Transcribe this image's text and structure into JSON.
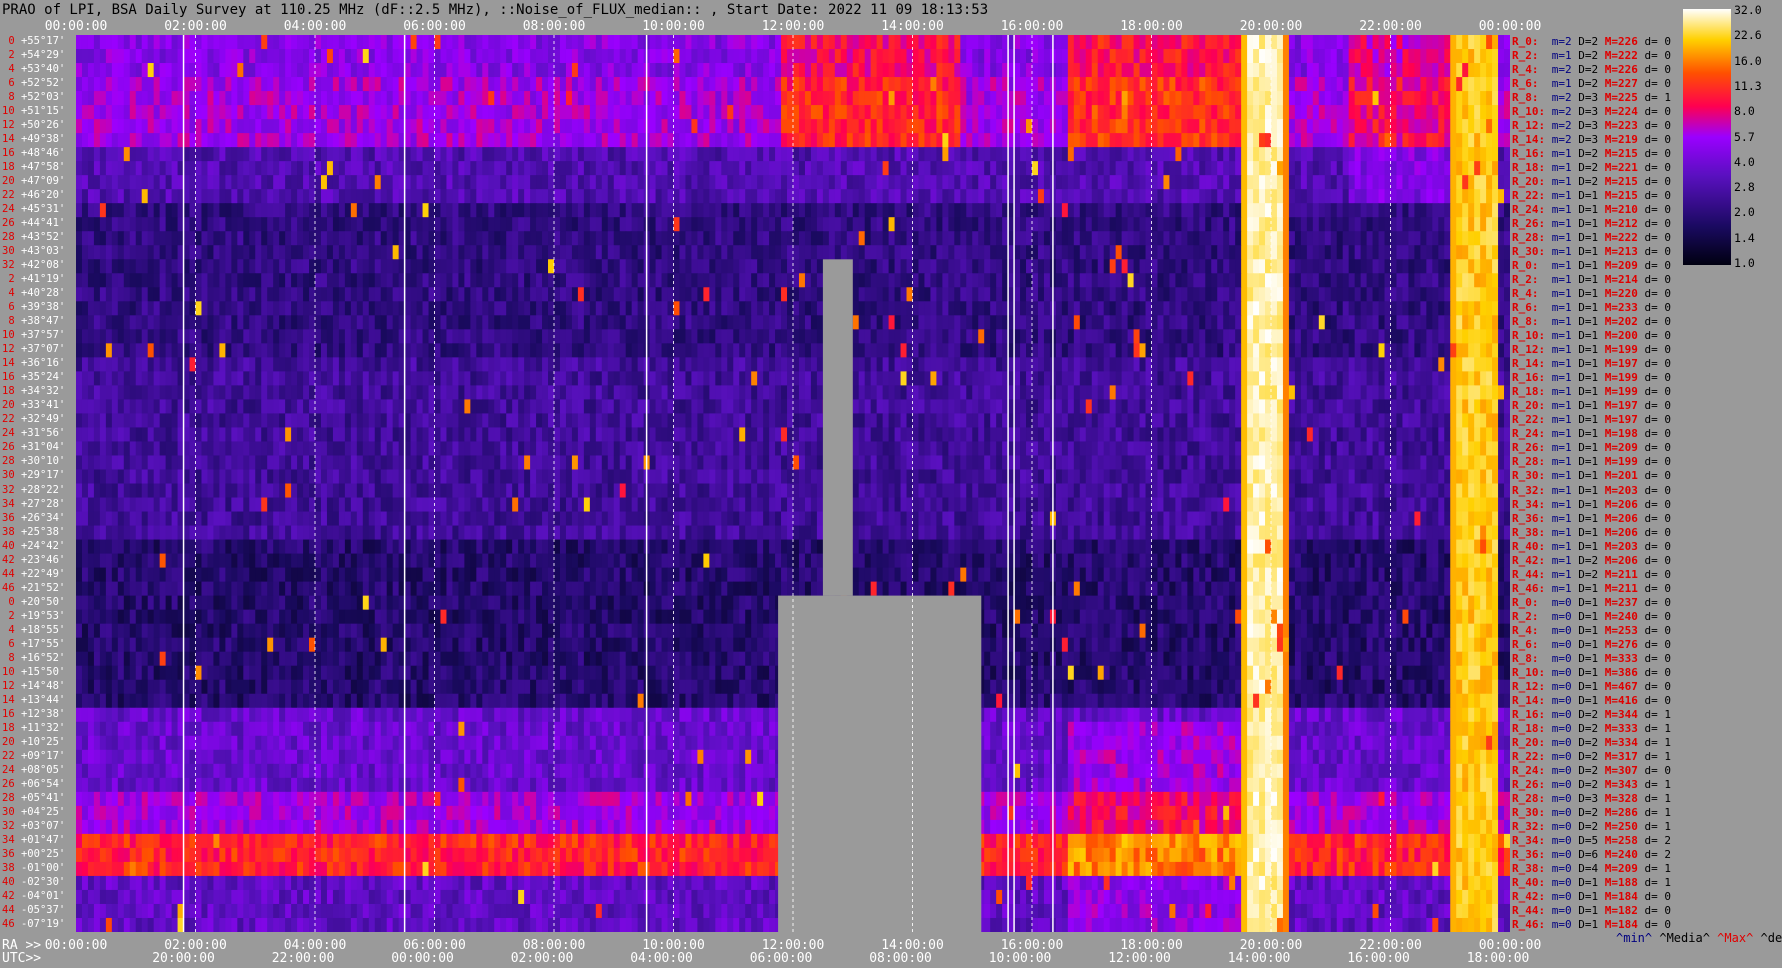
{
  "title": "PRAO of LPI, BSA Daily Survey at 110.25 MHz (dF::2.5 MHz), ::Noise_of_FLUX_median:: , Start Date: 2022 11 09 18:13:53",
  "top_ticks": [
    "00:00:00",
    "02:00:00",
    "04:00:00",
    "06:00:00",
    "08:00:00",
    "10:00:00",
    "12:00:00",
    "14:00:00",
    "16:00:00",
    "18:00:00",
    "20:00:00",
    "22:00:00",
    "00:00:00"
  ],
  "ra_prefix": "RA >>",
  "ra_ticks": [
    "00:00:00",
    "02:00:00",
    "04:00:00",
    "06:00:00",
    "08:00:00",
    "10:00:00",
    "12:00:00",
    "14:00:00",
    "16:00:00",
    "18:00:00",
    "20:00:00",
    "22:00:00",
    "00:00:00"
  ],
  "utc_prefix": "UTC>>",
  "utc_ticks": [
    "20:00:00",
    "22:00:00",
    "00:00:00",
    "02:00:00",
    "04:00:00",
    "06:00:00",
    "08:00:00",
    "10:00:00",
    "12:00:00",
    "14:00:00",
    "16:00:00",
    "18:00:00"
  ],
  "row_labels": [
    {
      "i": "0",
      "d": "+55°17'"
    },
    {
      "i": "2",
      "d": "+54°29'"
    },
    {
      "i": "4",
      "d": "+53°40'"
    },
    {
      "i": "6",
      "d": "+52°52'"
    },
    {
      "i": "8",
      "d": "+52°03'"
    },
    {
      "i": "10",
      "d": "+51°15'"
    },
    {
      "i": "12",
      "d": "+50°26'"
    },
    {
      "i": "14",
      "d": "+49°38'"
    },
    {
      "i": "16",
      "d": "+48°46'"
    },
    {
      "i": "18",
      "d": "+47°58'"
    },
    {
      "i": "20",
      "d": "+47°09'"
    },
    {
      "i": "22",
      "d": "+46°20'"
    },
    {
      "i": "24",
      "d": "+45°31'"
    },
    {
      "i": "26",
      "d": "+44°41'"
    },
    {
      "i": "28",
      "d": "+43°52'"
    },
    {
      "i": "30",
      "d": "+43°03'"
    },
    {
      "i": "32",
      "d": "+42°08'"
    },
    {
      "i": "2",
      "d": "+41°19'"
    },
    {
      "i": "4",
      "d": "+40°28'"
    },
    {
      "i": "6",
      "d": "+39°38'"
    },
    {
      "i": "8",
      "d": "+38°47'"
    },
    {
      "i": "10",
      "d": "+37°57'"
    },
    {
      "i": "12",
      "d": "+37°07'"
    },
    {
      "i": "14",
      "d": "+36°16'"
    },
    {
      "i": "16",
      "d": "+35°24'"
    },
    {
      "i": "18",
      "d": "+34°32'"
    },
    {
      "i": "20",
      "d": "+33°41'"
    },
    {
      "i": "22",
      "d": "+32°49'"
    },
    {
      "i": "24",
      "d": "+31°56'"
    },
    {
      "i": "26",
      "d": "+31°04'"
    },
    {
      "i": "28",
      "d": "+30°10'"
    },
    {
      "i": "30",
      "d": "+29°17'"
    },
    {
      "i": "32",
      "d": "+28°22'"
    },
    {
      "i": "34",
      "d": "+27°28'"
    },
    {
      "i": "36",
      "d": "+26°34'"
    },
    {
      "i": "38",
      "d": "+25°38'"
    },
    {
      "i": "40",
      "d": "+24°42'"
    },
    {
      "i": "42",
      "d": "+23°46'"
    },
    {
      "i": "44",
      "d": "+22°49'"
    },
    {
      "i": "46",
      "d": "+21°52'"
    },
    {
      "i": "0",
      "d": "+20°50'"
    },
    {
      "i": "2",
      "d": "+19°53'"
    },
    {
      "i": "4",
      "d": "+18°55'"
    },
    {
      "i": "6",
      "d": "+17°55'"
    },
    {
      "i": "8",
      "d": "+16°52'"
    },
    {
      "i": "10",
      "d": "+15°50'"
    },
    {
      "i": "12",
      "d": "+14°48'"
    },
    {
      "i": "14",
      "d": "+13°44'"
    },
    {
      "i": "16",
      "d": "+12°38'"
    },
    {
      "i": "18",
      "d": "+11°32'"
    },
    {
      "i": "20",
      "d": "+10°25'"
    },
    {
      "i": "22",
      "d": "+09°17'"
    },
    {
      "i": "24",
      "d": "+08°05'"
    },
    {
      "i": "26",
      "d": "+06°54'"
    },
    {
      "i": "28",
      "d": "+05°41'"
    },
    {
      "i": "30",
      "d": "+04°25'"
    },
    {
      "i": "32",
      "d": "+03°07'"
    },
    {
      "i": "34",
      "d": "+01°47'"
    },
    {
      "i": "36",
      "d": "+00°25'"
    },
    {
      "i": "38",
      "d": "-01°00'"
    },
    {
      "i": "40",
      "d": "-02°30'"
    },
    {
      "i": "42",
      "d": "-04°01'"
    },
    {
      "i": "44",
      "d": "-05°37'"
    },
    {
      "i": "46",
      "d": "-07°19'"
    }
  ],
  "stats": [
    [
      "R_0:",
      "m=2",
      "D=2",
      "M=226",
      "d= 0"
    ],
    [
      "R_2:",
      "m=1",
      "D=2",
      "M=222",
      "d= 0"
    ],
    [
      "R_4:",
      "m=2",
      "D=2",
      "M=226",
      "d= 0"
    ],
    [
      "R_6:",
      "m=1",
      "D=2",
      "M=227",
      "d= 0"
    ],
    [
      "R_8:",
      "m=2",
      "D=3",
      "M=225",
      "d= 1"
    ],
    [
      "R_10:",
      "m=2",
      "D=3",
      "M=224",
      "d= 0"
    ],
    [
      "R_12:",
      "m=2",
      "D=3",
      "M=223",
      "d= 0"
    ],
    [
      "R_14:",
      "m=2",
      "D=3",
      "M=219",
      "d= 0"
    ],
    [
      "R_16:",
      "m=1",
      "D=2",
      "M=215",
      "d= 0"
    ],
    [
      "R_18:",
      "m=1",
      "D=2",
      "M=221",
      "d= 0"
    ],
    [
      "R_20:",
      "m=1",
      "D=2",
      "M=215",
      "d= 0"
    ],
    [
      "R_22:",
      "m=1",
      "D=1",
      "M=215",
      "d= 0"
    ],
    [
      "R_24:",
      "m=1",
      "D=1",
      "M=210",
      "d= 0"
    ],
    [
      "R_26:",
      "m=1",
      "D=1",
      "M=212",
      "d= 0"
    ],
    [
      "R_28:",
      "m=1",
      "D=1",
      "M=222",
      "d= 0"
    ],
    [
      "R_30:",
      "m=1",
      "D=1",
      "M=213",
      "d= 0"
    ],
    [
      "R_0:",
      "m=1",
      "D=1",
      "M=209",
      "d= 0"
    ],
    [
      "R_2:",
      "m=1",
      "D=1",
      "M=214",
      "d= 0"
    ],
    [
      "R_4:",
      "m=1",
      "D=1",
      "M=220",
      "d= 0"
    ],
    [
      "R_6:",
      "m=1",
      "D=1",
      "M=233",
      "d= 0"
    ],
    [
      "R_8:",
      "m=1",
      "D=1",
      "M=202",
      "d= 0"
    ],
    [
      "R_10:",
      "m=1",
      "D=1",
      "M=200",
      "d= 0"
    ],
    [
      "R_12:",
      "m=1",
      "D=1",
      "M=199",
      "d= 0"
    ],
    [
      "R_14:",
      "m=1",
      "D=1",
      "M=197",
      "d= 0"
    ],
    [
      "R_16:",
      "m=1",
      "D=1",
      "M=199",
      "d= 0"
    ],
    [
      "R_18:",
      "m=1",
      "D=1",
      "M=199",
      "d= 0"
    ],
    [
      "R_20:",
      "m=1",
      "D=1",
      "M=197",
      "d= 0"
    ],
    [
      "R_22:",
      "m=1",
      "D=1",
      "M=197",
      "d= 0"
    ],
    [
      "R_24:",
      "m=1",
      "D=1",
      "M=198",
      "d= 0"
    ],
    [
      "R_26:",
      "m=1",
      "D=1",
      "M=209",
      "d= 0"
    ],
    [
      "R_28:",
      "m=1",
      "D=1",
      "M=199",
      "d= 0"
    ],
    [
      "R_30:",
      "m=1",
      "D=1",
      "M=201",
      "d= 0"
    ],
    [
      "R_32:",
      "m=1",
      "D=1",
      "M=203",
      "d= 0"
    ],
    [
      "R_34:",
      "m=1",
      "D=1",
      "M=206",
      "d= 0"
    ],
    [
      "R_36:",
      "m=1",
      "D=1",
      "M=206",
      "d= 0"
    ],
    [
      "R_38:",
      "m=1",
      "D=1",
      "M=206",
      "d= 0"
    ],
    [
      "R_40:",
      "m=1",
      "D=1",
      "M=203",
      "d= 0"
    ],
    [
      "R_42:",
      "m=1",
      "D=2",
      "M=206",
      "d= 0"
    ],
    [
      "R_44:",
      "m=1",
      "D=2",
      "M=211",
      "d= 0"
    ],
    [
      "R_46:",
      "m=1",
      "D=1",
      "M=211",
      "d= 0"
    ],
    [
      "R_0:",
      "m=0",
      "D=1",
      "M=237",
      "d= 0"
    ],
    [
      "R_2:",
      "m=0",
      "D=1",
      "M=240",
      "d= 0"
    ],
    [
      "R_4:",
      "m=0",
      "D=1",
      "M=253",
      "d= 0"
    ],
    [
      "R_6:",
      "m=0",
      "D=1",
      "M=276",
      "d= 0"
    ],
    [
      "R_8:",
      "m=0",
      "D=1",
      "M=333",
      "d= 0"
    ],
    [
      "R_10:",
      "m=0",
      "D=1",
      "M=386",
      "d= 0"
    ],
    [
      "R_12:",
      "m=0",
      "D=1",
      "M=467",
      "d= 0"
    ],
    [
      "R_14:",
      "m=0",
      "D=1",
      "M=416",
      "d= 0"
    ],
    [
      "R_16:",
      "m=0",
      "D=2",
      "M=344",
      "d= 1"
    ],
    [
      "R_18:",
      "m=0",
      "D=2",
      "M=333",
      "d= 1"
    ],
    [
      "R_20:",
      "m=0",
      "D=2",
      "M=334",
      "d= 1"
    ],
    [
      "R_22:",
      "m=0",
      "D=2",
      "M=317",
      "d= 1"
    ],
    [
      "R_24:",
      "m=0",
      "D=2",
      "M=307",
      "d= 0"
    ],
    [
      "R_26:",
      "m=0",
      "D=2",
      "M=343",
      "d= 1"
    ],
    [
      "R_28:",
      "m=0",
      "D=3",
      "M=328",
      "d= 1"
    ],
    [
      "R_30:",
      "m=0",
      "D=2",
      "M=286",
      "d= 1"
    ],
    [
      "R_32:",
      "m=0",
      "D=2",
      "M=250",
      "d= 1"
    ],
    [
      "R_34:",
      "m=0",
      "D=5",
      "M=258",
      "d= 2"
    ],
    [
      "R_36:",
      "m=0",
      "D=6",
      "M=240",
      "d= 2"
    ],
    [
      "R_38:",
      "m=0",
      "D=4",
      "M=209",
      "d= 1"
    ],
    [
      "R_40:",
      "m=0",
      "D=1",
      "M=188",
      "d= 1"
    ],
    [
      "R_42:",
      "m=0",
      "D=1",
      "M=184",
      "d= 0"
    ],
    [
      "R_44:",
      "m=0",
      "D=1",
      "M=182",
      "d= 0"
    ],
    [
      "R_46:",
      "m=0",
      "D=1",
      "M=184",
      "d= 0"
    ]
  ],
  "bottom_legend": {
    "min": "^min^",
    "median": "^Media^",
    "max": "^Max^",
    "devia": "^devia^"
  },
  "colorbar_ticks": [
    "32.0",
    "22.6",
    "16.0",
    "11.3",
    "8.0",
    "5.7",
    "4.0",
    "2.8",
    "2.0",
    "1.4",
    "1.0"
  ],
  "colors": {
    "low": "#000000",
    "mid1": "#3a1a90",
    "mid2": "#8a00ff",
    "mid3": "#ff0a40",
    "high": "#ffd000",
    "max": "#ffffff",
    "missing": "#9a9a9a"
  },
  "chart_data": {
    "type": "heatmap",
    "x_axis": "RA",
    "x_range": [
      "00:00:00",
      "24:00:00"
    ],
    "n_rows": 64,
    "scale": "log2",
    "zlim": [
      1.0,
      32.0
    ],
    "bright_columns_ra_hours": [
      19.75,
      23.5
    ],
    "missing_regions_ra_hours": [
      [
        11.75,
        15.15
      ],
      [
        12.5,
        13.2
      ]
    ],
    "bright_rows_dec": [
      "+01°47'",
      "+00°25'"
    ]
  }
}
